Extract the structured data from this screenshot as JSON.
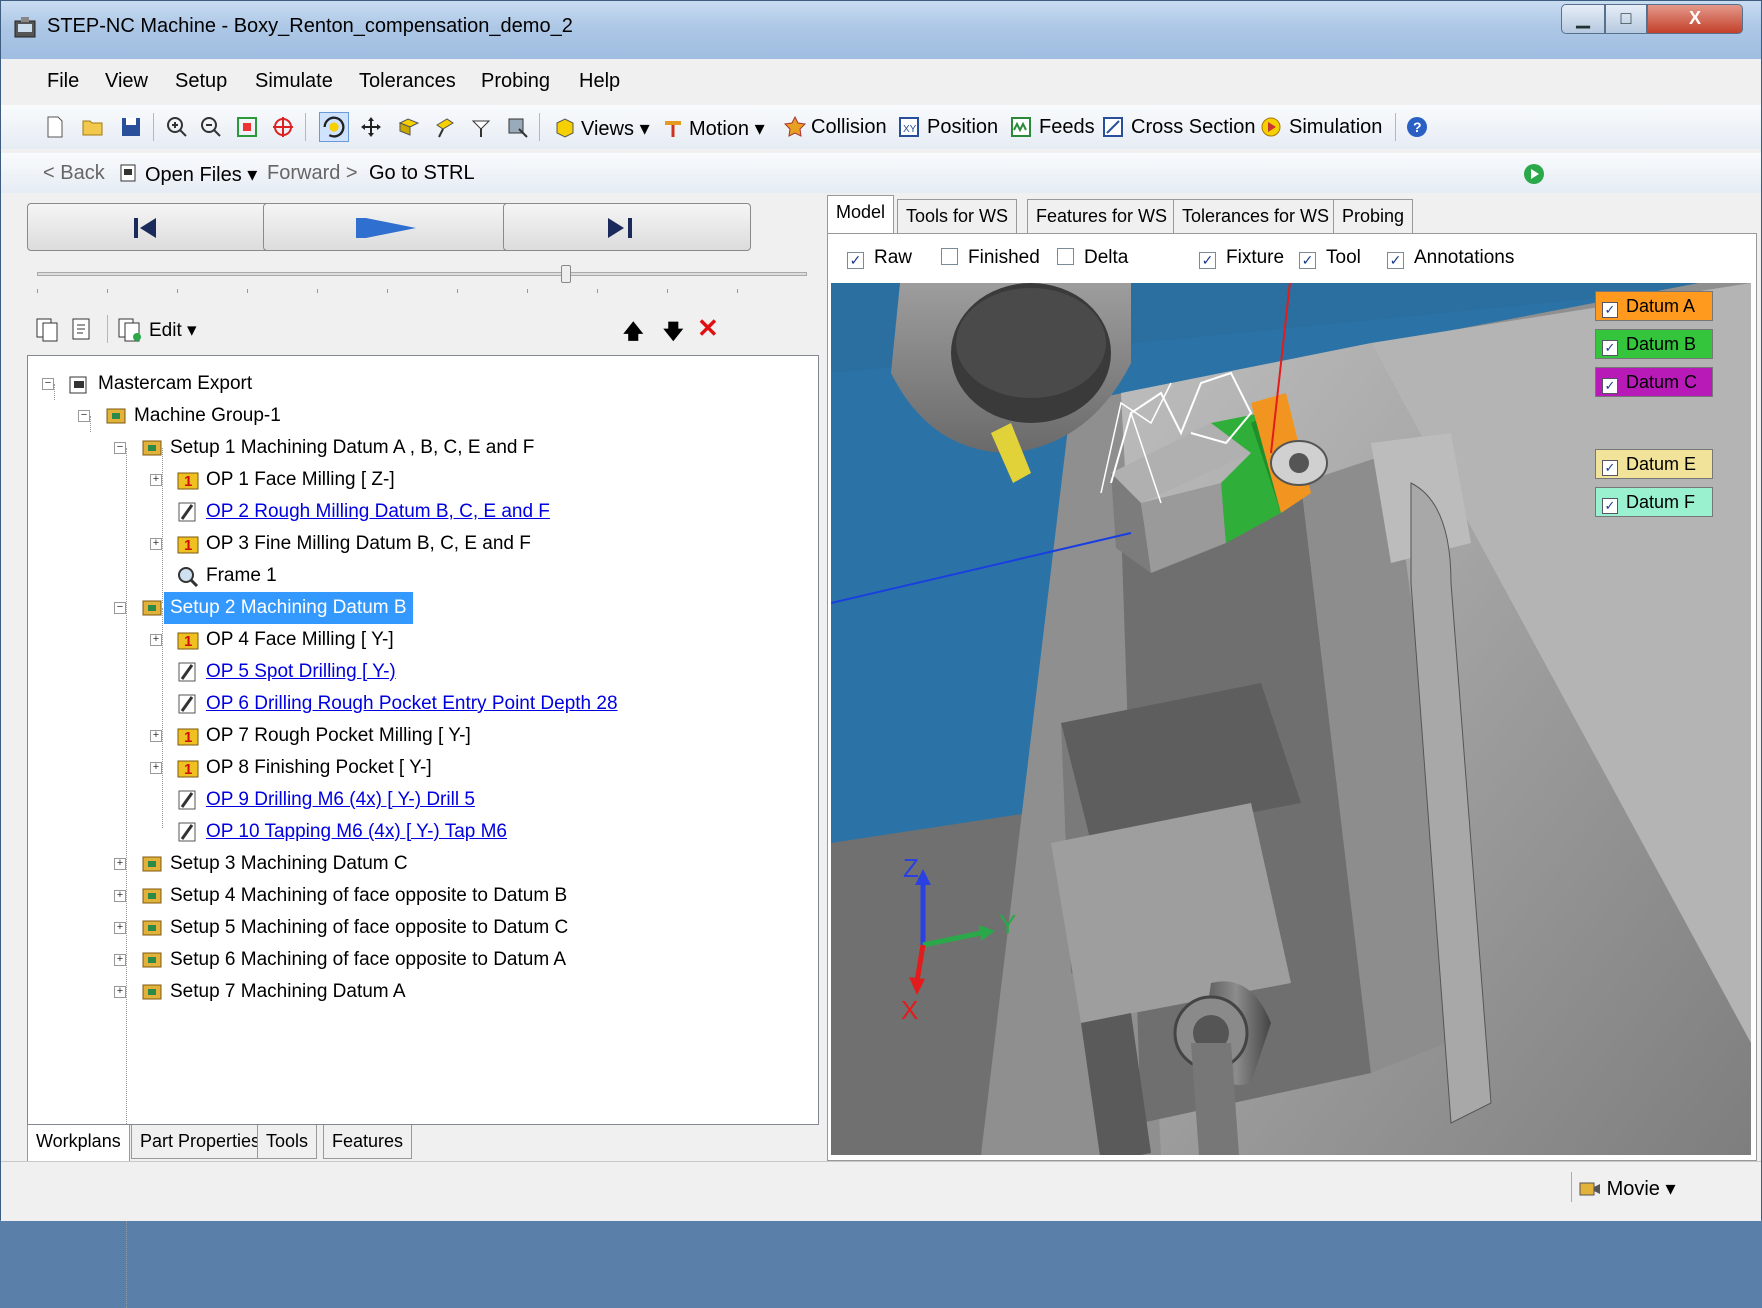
{
  "window": {
    "title": "STEP-NC Machine - Boxy_Renton_compensation_demo_2",
    "minimize_glyph": "▁",
    "maximize_glyph": "□",
    "close_glyph": "X"
  },
  "menu": [
    "File",
    "View",
    "Setup",
    "Simulate",
    "Tolerances",
    "Probing",
    "Help"
  ],
  "toolbar": {
    "views_label": "Views",
    "motion_label": "Motion",
    "collision_label": "Collision",
    "position_label": "Position",
    "feeds_label": "Feeds",
    "cross_section_label": "Cross Section",
    "simulation_label": "Simulation",
    "dropdown_glyph": "▾"
  },
  "nav": {
    "back_label": "< Back",
    "open_files_label": "Open Files",
    "forward_label": "Forward >",
    "goto_label": "Go to STRL"
  },
  "playback": {
    "slider_value_fraction": 0.69
  },
  "tree_toolbar": {
    "edit_label": "Edit",
    "up_glyph": "🡅",
    "down_glyph": "🡇",
    "delete_glyph": "✕"
  },
  "tree": {
    "root": "Mastercam Export",
    "machine_group": "Machine Group-1",
    "setup1": "Setup 1 Machining Datum A , B, C, E and F",
    "op1": "OP 1 Face Milling [ Z-]",
    "op2": "OP 2 Rough Milling Datum B, C, E and F",
    "op3": "OP 3 Fine Milling Datum B, C, E and F",
    "frame1": "Frame 1",
    "setup2": "Setup 2 Machining Datum B",
    "op4": "OP 4 Face Milling [ Y-]",
    "op5": "OP 5 Spot Drilling  [ Y-)",
    "op6": "OP 6 Drilling Rough Pocket Entry Point  Depth 28",
    "op7": "OP 7 Rough Pocket Milling [ Y-]",
    "op8": "OP 8 Finishing Pocket [ Y-]",
    "op9": "OP 9 Drilling M6 (4x) [ Y-) Drill 5",
    "op10": "OP 10 Tapping M6 (4x) [ Y-) Tap M6",
    "setup3": "Setup 3 Machining Datum C",
    "setup4": "Setup 4 Machining of face opposite to Datum B",
    "setup5": "Setup 5 Machining of face opposite to Datum C",
    "setup6": "Setup 6 Machining of face opposite to Datum A",
    "setup7": "Setup 7 Machining Datum A",
    "expand_glyph": "+",
    "collapse_glyph": "−",
    "op_number_glyph": "1"
  },
  "left_tabs": [
    "Workplans",
    "Part Properties",
    "Tools",
    "Features"
  ],
  "right_tabs": [
    "Model",
    "Tools for WS",
    "Features for WS",
    "Tolerances for WS",
    "Probing"
  ],
  "display_checks": {
    "raw": "Raw",
    "finished": "Finished",
    "delta": "Delta",
    "fixture": "Fixture",
    "tool": "Tool",
    "annotations": "Annotations",
    "check_glyph": "✓"
  },
  "datums": {
    "a": "Datum A",
    "b": "Datum B",
    "c": "Datum C",
    "e": "Datum E",
    "f": "Datum F",
    "colors": {
      "a": "#ff9a1e",
      "b": "#34c53c",
      "c": "#b81ab8",
      "e": "#f1e49a",
      "f": "#9af1cf"
    }
  },
  "axes": {
    "x": "X",
    "y": "Y",
    "z": "Z"
  },
  "statusbar": {
    "movie_label": "Movie",
    "dropdown_glyph": "▾"
  },
  "colors": {
    "selection": "#3399ff",
    "link": "#0000e0",
    "viewport_bg": "#2a6f9f"
  }
}
